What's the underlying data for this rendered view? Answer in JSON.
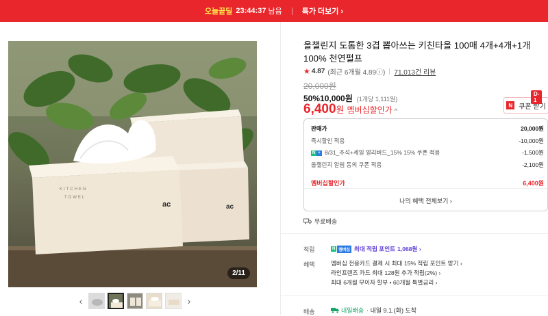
{
  "topbar": {
    "deal_label": "오늘끝딜",
    "timer": "23:44:37",
    "remain": "남음",
    "more": "특가 더보기 ›"
  },
  "gallery": {
    "page_indicator": "2/11",
    "box_text_1": "KITCHEN",
    "box_text_2": "TOWEL",
    "box_brand": "ac",
    "prev": "‹",
    "next": "›"
  },
  "product": {
    "title": "올챌린지 도톰한 3겹 뽑아쓰는 키친타올 100매 4개+4개+1개 100% 천연펄프",
    "rating_star": "★",
    "rating": "4.87",
    "rating_sub": "(최근 6개월 4.89ⓘ)",
    "reviews": "71,013건 리뷰",
    "original_price": "20,000원",
    "discount_pct": "50%",
    "discount_price": "10,000원",
    "per_unit": "(1개당 1,111원)",
    "member_price": "6,400",
    "member_won": "원",
    "member_label": "멤버십할인가",
    "member_caret": "^"
  },
  "coupon": {
    "dday": "D-1",
    "n": "N",
    "label": "쿠폰 받기"
  },
  "breakdown": {
    "rows": [
      {
        "label": "판매가",
        "value": "20,000원"
      },
      {
        "label": "즉시할인 적용",
        "value": "-10,000원"
      },
      {
        "label": "8/31_추석+세일 얼리버드_15% 15% 쿠폰 적용",
        "value": "-1,500원"
      },
      {
        "label": "올챌린지 알림 동의 쿠폰 적용",
        "value": "-2,100원"
      }
    ],
    "total_label": "멤버십할인가",
    "total_value": "6,400원",
    "view_all": "나의 혜택 전체보기 ›"
  },
  "shipping": {
    "free": "무료배송"
  },
  "points": {
    "label": "적립",
    "tag1": "N",
    "tag2": "멤버십",
    "text": "최대 적립 포인트",
    "amount": "1,068원 ›"
  },
  "benefits": {
    "label": "혜택",
    "lines": [
      "멤버십 전용카드 결제 시 최대 15% 적립 포인트 받기 ›",
      "라인프렌즈 카드 최대 128원 추가 적립(2%) ›",
      "최대 6개월 무이자 할부 • 60개월 특별금리 ›"
    ]
  },
  "delivery": {
    "label": "배송",
    "badge": "내일배송",
    "date": "· 내일 9.1.(화) 도착"
  },
  "colors": {
    "brand_red": "#e8262b",
    "naver_green": "#19c37d",
    "point_purple": "#5b3bd6"
  }
}
